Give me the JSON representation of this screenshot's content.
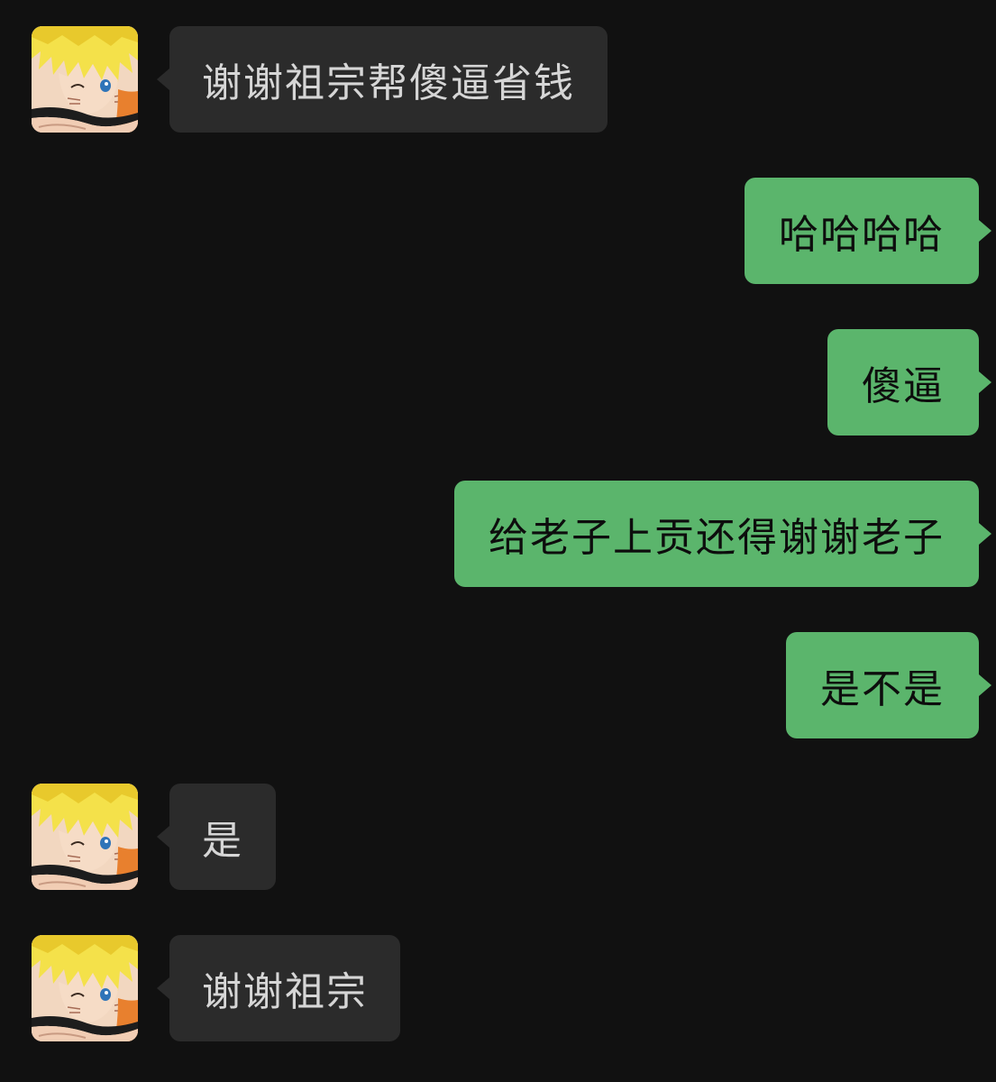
{
  "colors": {
    "background": "#111111",
    "incoming_bubble": "#2b2b2b",
    "incoming_text": "#d6d6d6",
    "outgoing_bubble": "#5bb56c",
    "outgoing_text": "#0d0d0d"
  },
  "messages": [
    {
      "direction": "incoming",
      "text": "谢谢祖宗帮傻逼省钱",
      "avatar": "anime-boy-avatar"
    },
    {
      "direction": "outgoing",
      "text": "哈哈哈哈"
    },
    {
      "direction": "outgoing",
      "text": "傻逼"
    },
    {
      "direction": "outgoing",
      "text": "给老子上贡还得谢谢老子"
    },
    {
      "direction": "outgoing",
      "text": "是不是"
    },
    {
      "direction": "incoming",
      "text": "是",
      "avatar": "anime-boy-avatar"
    },
    {
      "direction": "incoming",
      "text": "谢谢祖宗",
      "avatar": "anime-boy-avatar"
    }
  ]
}
